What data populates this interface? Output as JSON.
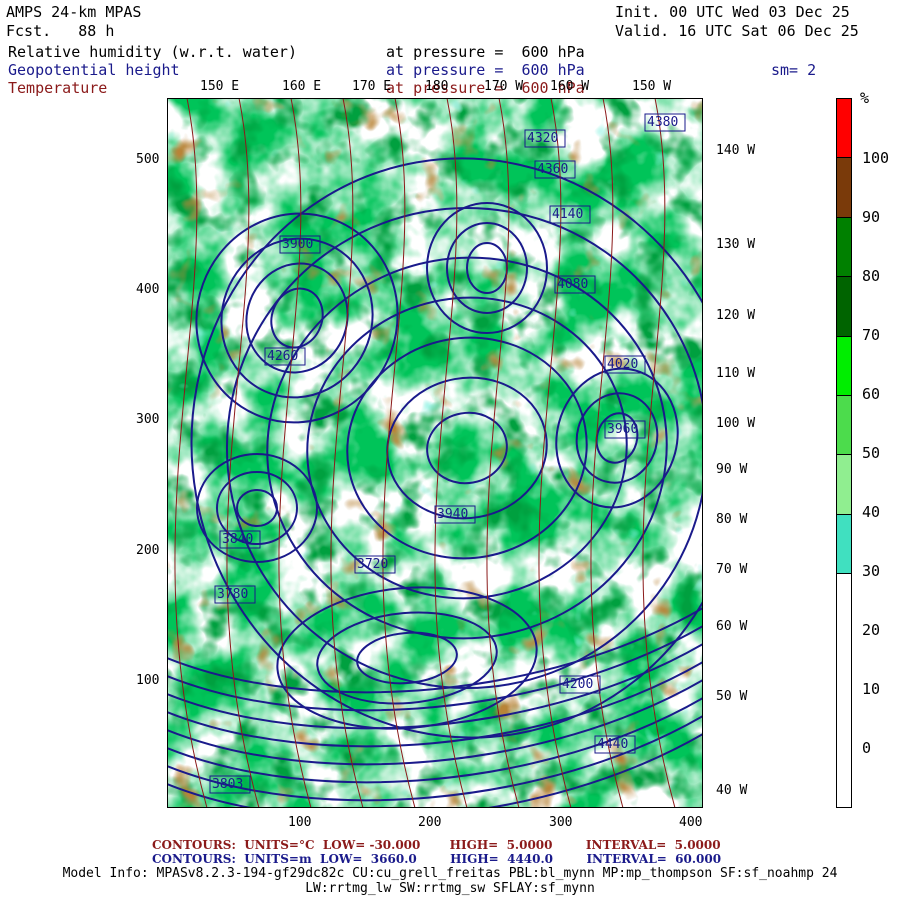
{
  "header": {
    "model": "AMPS 24-km MPAS",
    "fcst": "Fcst.   88 h",
    "init": "Init. 00 UTC Wed 03 Dec 25",
    "valid": "Valid. 16 UTC Sat 06 Dec 25",
    "fields": [
      {
        "name": "Relative humidity (w.r.t. water)",
        "level": "at pressure =  600 hPa",
        "color": "#000000"
      },
      {
        "name": "Geopotential height",
        "level": "at pressure =  600 hPa",
        "color": "#1a1a8b"
      },
      {
        "name": "Temperature",
        "level": "at pressure =  600 hPa",
        "color": "#8b1a1a"
      }
    ],
    "smoothing": "sm= 2"
  },
  "map": {
    "top_lon_labels": [
      "150 E",
      "160 E",
      "170 E",
      "180",
      "170 W",
      "160 W",
      "150 W"
    ],
    "right_lon_labels": [
      "140 W",
      "130 W",
      "120 W",
      "110 W",
      "100 W",
      "90 W",
      "80 W",
      "70 W",
      "60 W",
      "50 W",
      "40 W"
    ],
    "x_ticks": [
      "100",
      "200",
      "300",
      "400"
    ],
    "y_ticks": [
      "500",
      "400",
      "300",
      "200",
      "100"
    ],
    "height_labels": [
      "4380",
      "4320",
      "4360",
      "4140",
      "4080",
      "4260",
      "4020",
      "3960",
      "3900",
      "3840",
      "3780",
      "3720",
      "4200",
      "4440",
      "3803",
      "3940"
    ],
    "colors": {
      "contour_height": "#1a1a8b",
      "contour_temp": "#8b1a1a",
      "land": "#222222"
    }
  },
  "colorbar": {
    "unit": "%",
    "labels": [
      "100",
      "90",
      "80",
      "70",
      "60",
      "50",
      "40",
      "30",
      "20",
      "10",
      "0"
    ],
    "bins": [
      {
        "from": 0,
        "to": 30,
        "color": "#ffffff"
      },
      {
        "from": 30,
        "to": 40,
        "color": "#40e0c0"
      },
      {
        "from": 40,
        "to": 50,
        "color": "#90ee90"
      },
      {
        "from": 50,
        "to": 60,
        "color": "#4cdc4c"
      },
      {
        "from": 60,
        "to": 70,
        "color": "#00ee00"
      },
      {
        "from": 70,
        "to": 80,
        "color": "#006400"
      },
      {
        "from": 80,
        "to": 90,
        "color": "#008000"
      },
      {
        "from": 90,
        "to": 100,
        "color": "#7a3a0a"
      },
      {
        "from": 100,
        "to": 110,
        "color": "#ff0000"
      }
    ]
  },
  "footer": {
    "temp_contours": {
      "label": "CONTOURS:",
      "units": "UNITS=°C",
      "low": "LOW= -30.000",
      "high": "HIGH=  5.0000",
      "interval": "INTERVAL=  5.0000"
    },
    "height_contours": {
      "label": "CONTOURS:",
      "units": "UNITS=m",
      "low": "LOW=  3660.0",
      "high": "HIGH=  4440.0",
      "interval": "INTERVAL=  60.000"
    },
    "model_info_1": "Model Info: MPASv8.2.3-194-gf29dc82c CU:cu_grell_freitas PBL:bl_mynn MP:mp_thompson SF:sf_noahmp 24",
    "model_info_2": "LW:rrtmg_lw SW:rrtmg_sw SFLAY:sf_mynn"
  }
}
